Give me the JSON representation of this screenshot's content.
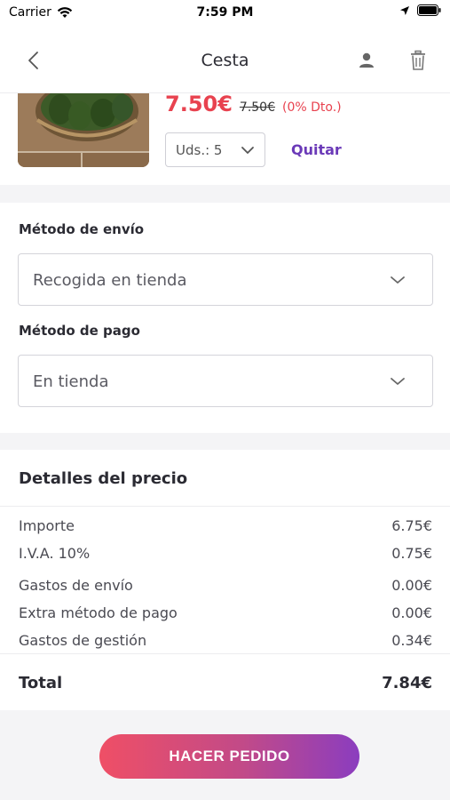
{
  "status_bar": {
    "carrier": "Carrier",
    "time": "7:59 PM"
  },
  "nav": {
    "title": "Cesta"
  },
  "product": {
    "price": "7.50€",
    "old_price": "7.50€",
    "discount": "(0% Dto.)",
    "quantity_label": "Uds.: 5",
    "remove_label": "Quitar"
  },
  "shipping": {
    "label": "Método de envío",
    "value": "Recogida en tienda"
  },
  "payment": {
    "label": "Método de pago",
    "value": "En tienda"
  },
  "price_details": {
    "title": "Detalles del precio",
    "rows": [
      {
        "label": "Importe",
        "value": "6.75€"
      },
      {
        "label": "I.V.A. 10%",
        "value": "0.75€"
      },
      {
        "label": "Gastos de envío",
        "value": "0.00€"
      },
      {
        "label": "Extra método de pago",
        "value": "0.00€"
      },
      {
        "label": "Gastos de gestión",
        "value": "0.34€"
      }
    ],
    "total_label": "Total",
    "total_value": "7.84€"
  },
  "cta": {
    "label": "HACER PEDIDO"
  },
  "colors": {
    "accent": "#e8424f",
    "purple": "#6b3ab8"
  },
  "icons": [
    "wifi-icon",
    "back-chevron-icon",
    "user-icon",
    "trash-icon",
    "chevron-down-icon",
    "location-arrow-icon",
    "battery-icon"
  ]
}
